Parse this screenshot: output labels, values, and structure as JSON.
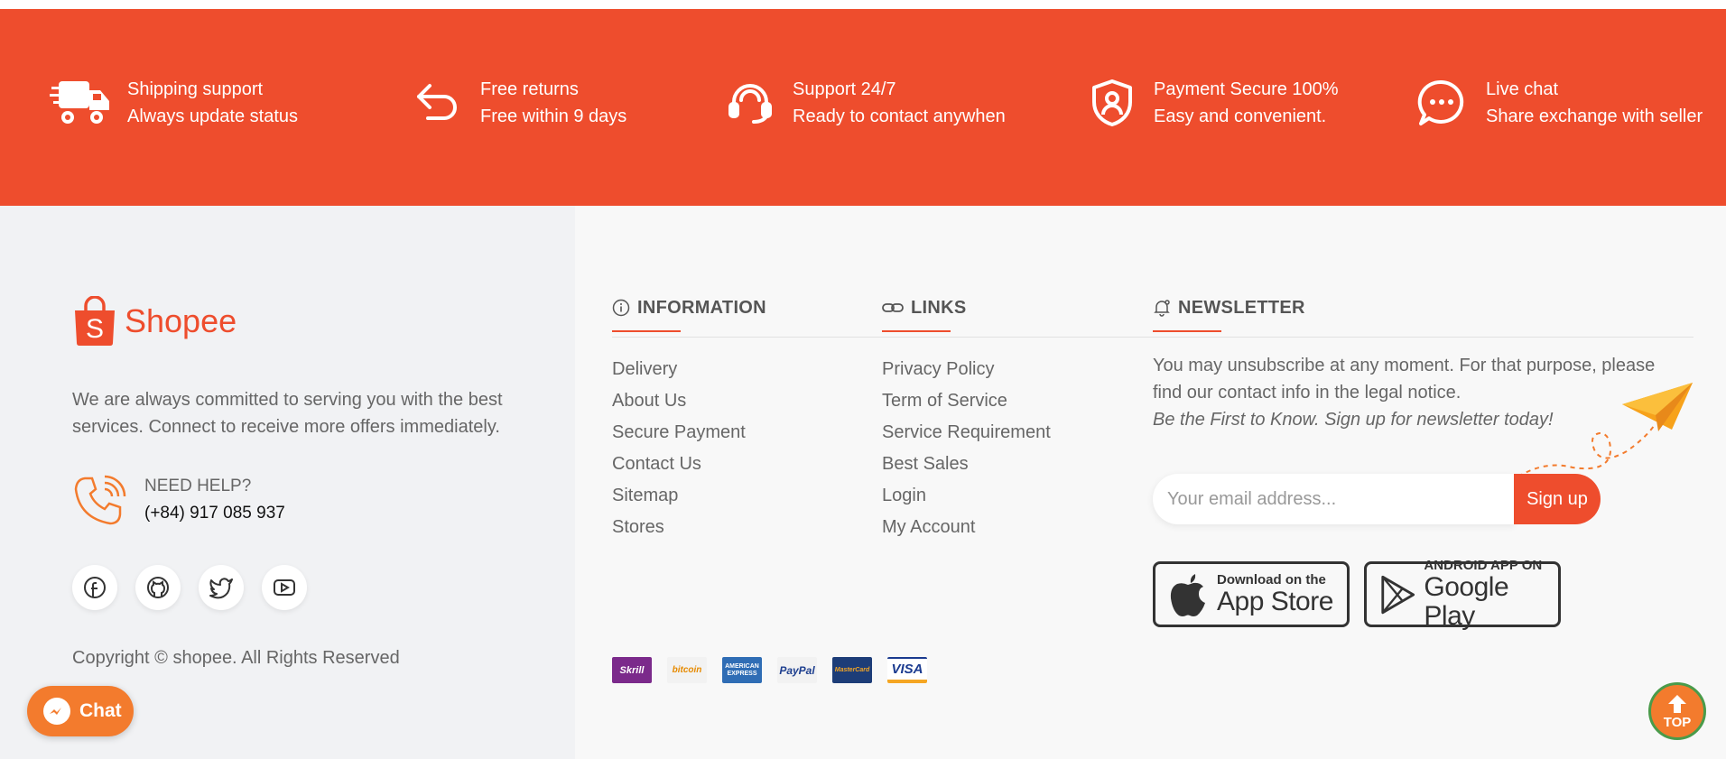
{
  "features": [
    {
      "icon": "truck-icon",
      "line1": "Shipping support",
      "line2": "Always update status"
    },
    {
      "icon": "return-arrow-icon",
      "line1": "Free returns",
      "line2": "Free within 9 days"
    },
    {
      "icon": "headset-icon",
      "line1": "Support 24/7",
      "line2": "Ready to contact anywhen"
    },
    {
      "icon": "shield-user-icon",
      "line1": "Payment Secure 100%",
      "line2": "Easy and convenient."
    },
    {
      "icon": "chat-bubble-icon",
      "line1": "Live chat",
      "line2": "Share exchange with seller"
    }
  ],
  "brand": {
    "name": "Shopee",
    "color": "#ee4d2d"
  },
  "about": "We are always committed to serving you with the best services. Connect to receive more offers immediately.",
  "help": {
    "label": "NEED HELP?",
    "phone": "(+84) 917 085 937"
  },
  "socials": [
    "facebook-icon",
    "github-icon",
    "twitter-icon",
    "youtube-icon"
  ],
  "copyright": "Copyright © shopee. All Rights Reserved",
  "information": {
    "title": "INFORMATION",
    "items": [
      "Delivery",
      "About Us",
      "Secure Payment",
      "Contact Us",
      "Sitemap",
      "Stores"
    ]
  },
  "links": {
    "title": "LINKS",
    "items": [
      "Privacy Policy",
      "Term of Service",
      "Service Requirement",
      "Best Sales",
      "Login",
      "My Account"
    ]
  },
  "newsletter": {
    "title": "NEWSLETTER",
    "text": "You may unsubscribe at any moment. For that purpose, please find our contact info in the legal notice.",
    "tagline": "Be the First to Know. Sign up for newsletter today!",
    "placeholder": "Your email address...",
    "button": "Sign up"
  },
  "stores": {
    "apple": {
      "line1": "Download on the",
      "line2": "App Store"
    },
    "google": {
      "line1": "ANDROID APP ON",
      "line2": "Google Play"
    }
  },
  "payments": [
    "Skrill",
    "bitcoin",
    "AMERICAN EXPRESS",
    "PayPal",
    "MasterCard",
    "VISA"
  ],
  "chat_button": "Chat",
  "top_button": "TOP"
}
